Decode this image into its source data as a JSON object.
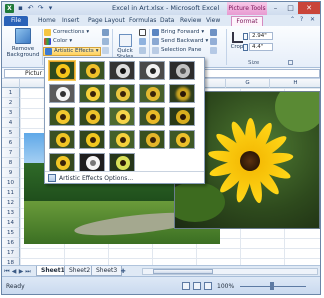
{
  "titlebar": {
    "title": "Excel in Art.xlsx - Microsoft Excel",
    "context_tab_group": "Picture Tools",
    "app_icon_letter": "X"
  },
  "ribbon_tabs": [
    "File",
    "Home",
    "Insert",
    "Page Layout",
    "Formulas",
    "Data",
    "Review",
    "View",
    "Format"
  ],
  "ribbon": {
    "remove_background": "Remove Background",
    "corrections": "Corrections",
    "color": "Color",
    "artistic_effects": "Artistic Effects",
    "quick_styles": "Quick Styles",
    "bring_forward": "Bring Forward",
    "send_backward": "Send Backward",
    "selection_pane": "Selection Pane",
    "crop": "Crop",
    "height_value": "2.94\"",
    "width_value": "4.4\"",
    "size_group_label": "Size"
  },
  "formula_bar": {
    "name_box": "Pictur"
  },
  "columns": [
    "",
    "B",
    "",
    "",
    "",
    "G",
    "H"
  ],
  "rows": [
    "1",
    "2",
    "3",
    "4",
    "5",
    "6",
    "7",
    "8",
    "9",
    "10",
    "11",
    "12",
    "13",
    "14",
    "15",
    "16",
    "17",
    "18"
  ],
  "artistic_gallery": {
    "thumb_count": 23,
    "options_label": "Artistic Effects Options..."
  },
  "sheet_tabs": [
    "Sheet1",
    "Sheet2",
    "Sheet3"
  ],
  "status": {
    "ready": "Ready",
    "zoom": "100%"
  },
  "colors": {
    "file_tab": "#2a62b8",
    "picture_tools": "#e79ad1",
    "artistic_highlight": "#ffd15c",
    "close_button": "#c9453a"
  }
}
